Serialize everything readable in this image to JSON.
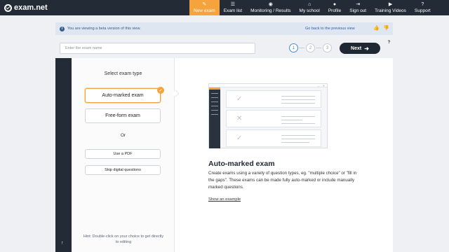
{
  "nav": {
    "logo_text": "exam.net",
    "items": [
      {
        "label": "New exam",
        "icon": "pencil-icon",
        "active": true
      },
      {
        "label": "Exam list",
        "icon": "list-icon"
      },
      {
        "label": "Monitoring / Results",
        "icon": "eye-icon"
      },
      {
        "label": "My school",
        "icon": "school-icon"
      },
      {
        "label": "Profile",
        "icon": "user-icon"
      },
      {
        "label": "Sign out",
        "icon": "sign-out-icon"
      },
      {
        "label": "Training Videos",
        "icon": "play-icon"
      },
      {
        "label": "Support",
        "icon": "question-icon"
      }
    ],
    "accent_color": "#f6a33b",
    "bar_color": "#222b36"
  },
  "beta_bar": {
    "message": "You are viewing a beta version of this view.",
    "back_link": "Go back to the previous view"
  },
  "exam_name": {
    "placeholder": "Enter the exam name",
    "value": ""
  },
  "steps": [
    "1",
    "2",
    "3"
  ],
  "current_step": 1,
  "next_button": "Next",
  "left_panel": {
    "title": "Select exam type",
    "options": [
      "Auto-marked exam",
      "Free-form exam"
    ],
    "selected": "Auto-marked exam",
    "or_text": "Or",
    "secondary_options": [
      "Use a PDF",
      "Skip digital questions"
    ],
    "hint": "Hint: Double-click on your choice to get directly to editing"
  },
  "detail": {
    "title": "Auto-marked exam",
    "description": "Create exams using a variety of question types, eg. \"multiple choice\" or \"fill in the gaps\". These exams can be made fully auto-marked or include manually marked questions.",
    "example_link": "Show an example"
  }
}
